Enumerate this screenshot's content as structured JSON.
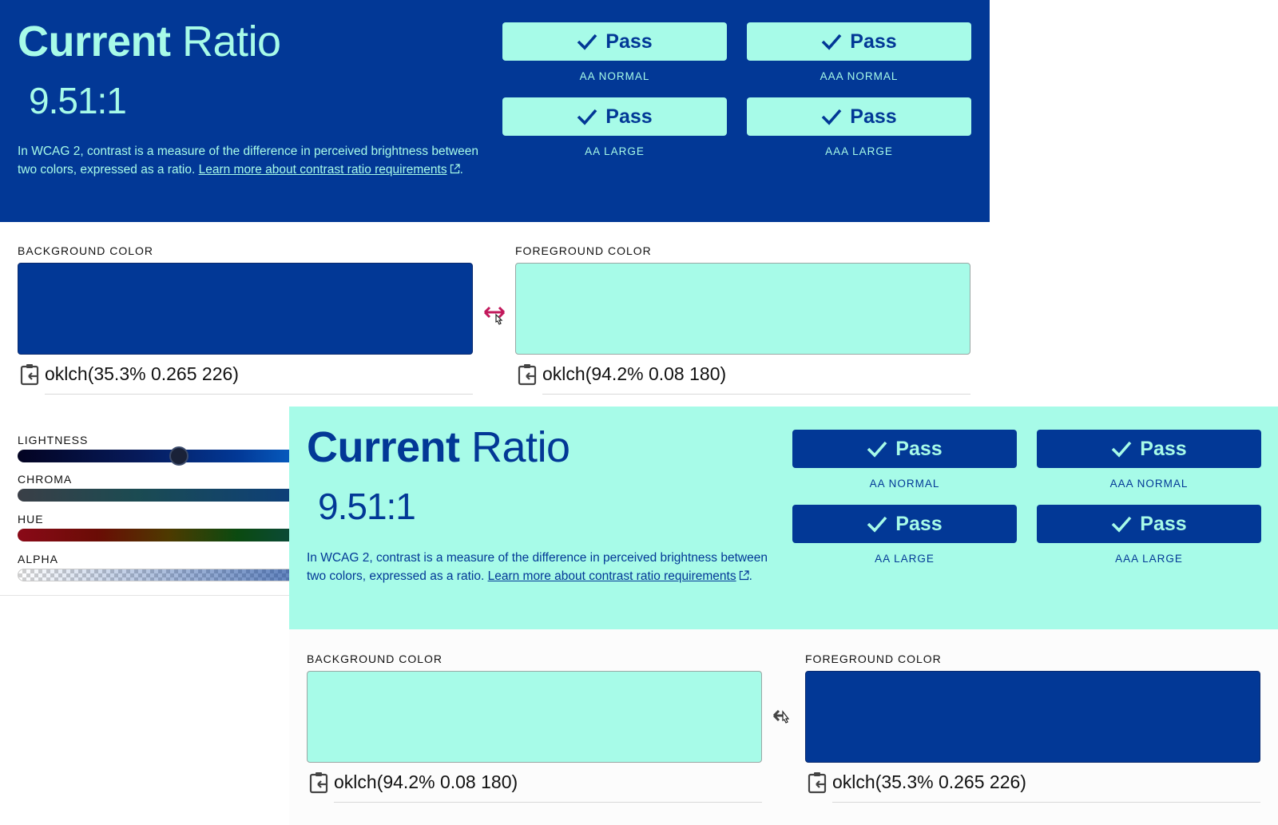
{
  "back_panel": {
    "title_bold": "Current",
    "title_light": "Ratio",
    "ratio": "9.51:1",
    "desc_text": "In WCAG 2, contrast is a measure of the difference in perceived brightness between two colors, expressed as a ratio. ",
    "desc_link": "Learn more about contrast ratio requirements",
    "desc_end": ".",
    "checks": [
      {
        "button": "Pass",
        "label": "AA NORMAL"
      },
      {
        "button": "Pass",
        "label": "AAA NORMAL"
      },
      {
        "button": "Pass",
        "label": "AA LARGE"
      },
      {
        "button": "Pass",
        "label": "AAA LARGE"
      }
    ],
    "background": {
      "label": "BACKGROUND COLOR",
      "value": "oklch(35.3% 0.265 226)",
      "color": "#023896"
    },
    "foreground": {
      "label": "FOREGROUND COLOR",
      "value": "oklch(94.2% 0.08 180)",
      "color": "#a7fbe8"
    },
    "sliders": {
      "lightness": {
        "label": "LIGHTNESS",
        "value": 0.403
      },
      "chroma": {
        "label": "CHROMA"
      },
      "hue": {
        "label": "HUE"
      },
      "alpha": {
        "label": "ALPHA"
      }
    }
  },
  "front_panel": {
    "title_bold": "Current",
    "title_light": "Ratio",
    "ratio": "9.51:1",
    "desc_text": "In WCAG 2, contrast is a measure of the difference in perceived brightness between two colors, expressed as a ratio. ",
    "desc_link": "Learn more about contrast ratio requirements",
    "desc_end": ".",
    "checks": [
      {
        "button": "Pass",
        "label": "AA NORMAL"
      },
      {
        "button": "Pass",
        "label": "AAA NORMAL"
      },
      {
        "button": "Pass",
        "label": "AA LARGE"
      },
      {
        "button": "Pass",
        "label": "AAA LARGE"
      }
    ],
    "background": {
      "label": "BACKGROUND COLOR",
      "value": "oklch(94.2% 0.08 180)",
      "color": "#a7fbe8"
    },
    "foreground": {
      "label": "FOREGROUND COLOR",
      "value": "oklch(35.3% 0.265 226)",
      "color": "#023896"
    }
  },
  "colors": {
    "navy": "#023896",
    "mint": "#a7fbe8",
    "swap_accent": "#c2185b"
  },
  "icons": {
    "check": "check-icon",
    "external": "external-link-icon",
    "clipboard": "clipboard-copy-icon",
    "swap": "swap-colors-icon"
  }
}
